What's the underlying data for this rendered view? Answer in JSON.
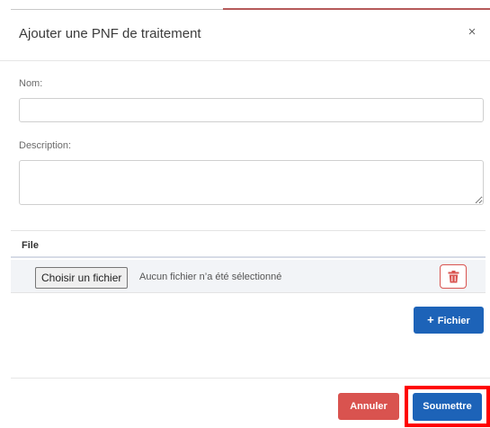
{
  "modal": {
    "title": "Ajouter une PNF de traitement",
    "close_icon": "×"
  },
  "form": {
    "name_label": "Nom:",
    "name_value": "",
    "description_label": "Description:",
    "description_value": ""
  },
  "files": {
    "header": "File",
    "choose_label": "Choisir un fichier",
    "no_file_text": "Aucun fichier n’a été sélectionné",
    "delete_icon": "trash-icon",
    "add_label": "Fichier",
    "add_icon": "+"
  },
  "footer": {
    "cancel_label": "Annuler",
    "submit_label": "Soumettre"
  },
  "colors": {
    "primary": "#1d63b8",
    "danger": "#d9534f",
    "highlight": "#ff0000"
  }
}
